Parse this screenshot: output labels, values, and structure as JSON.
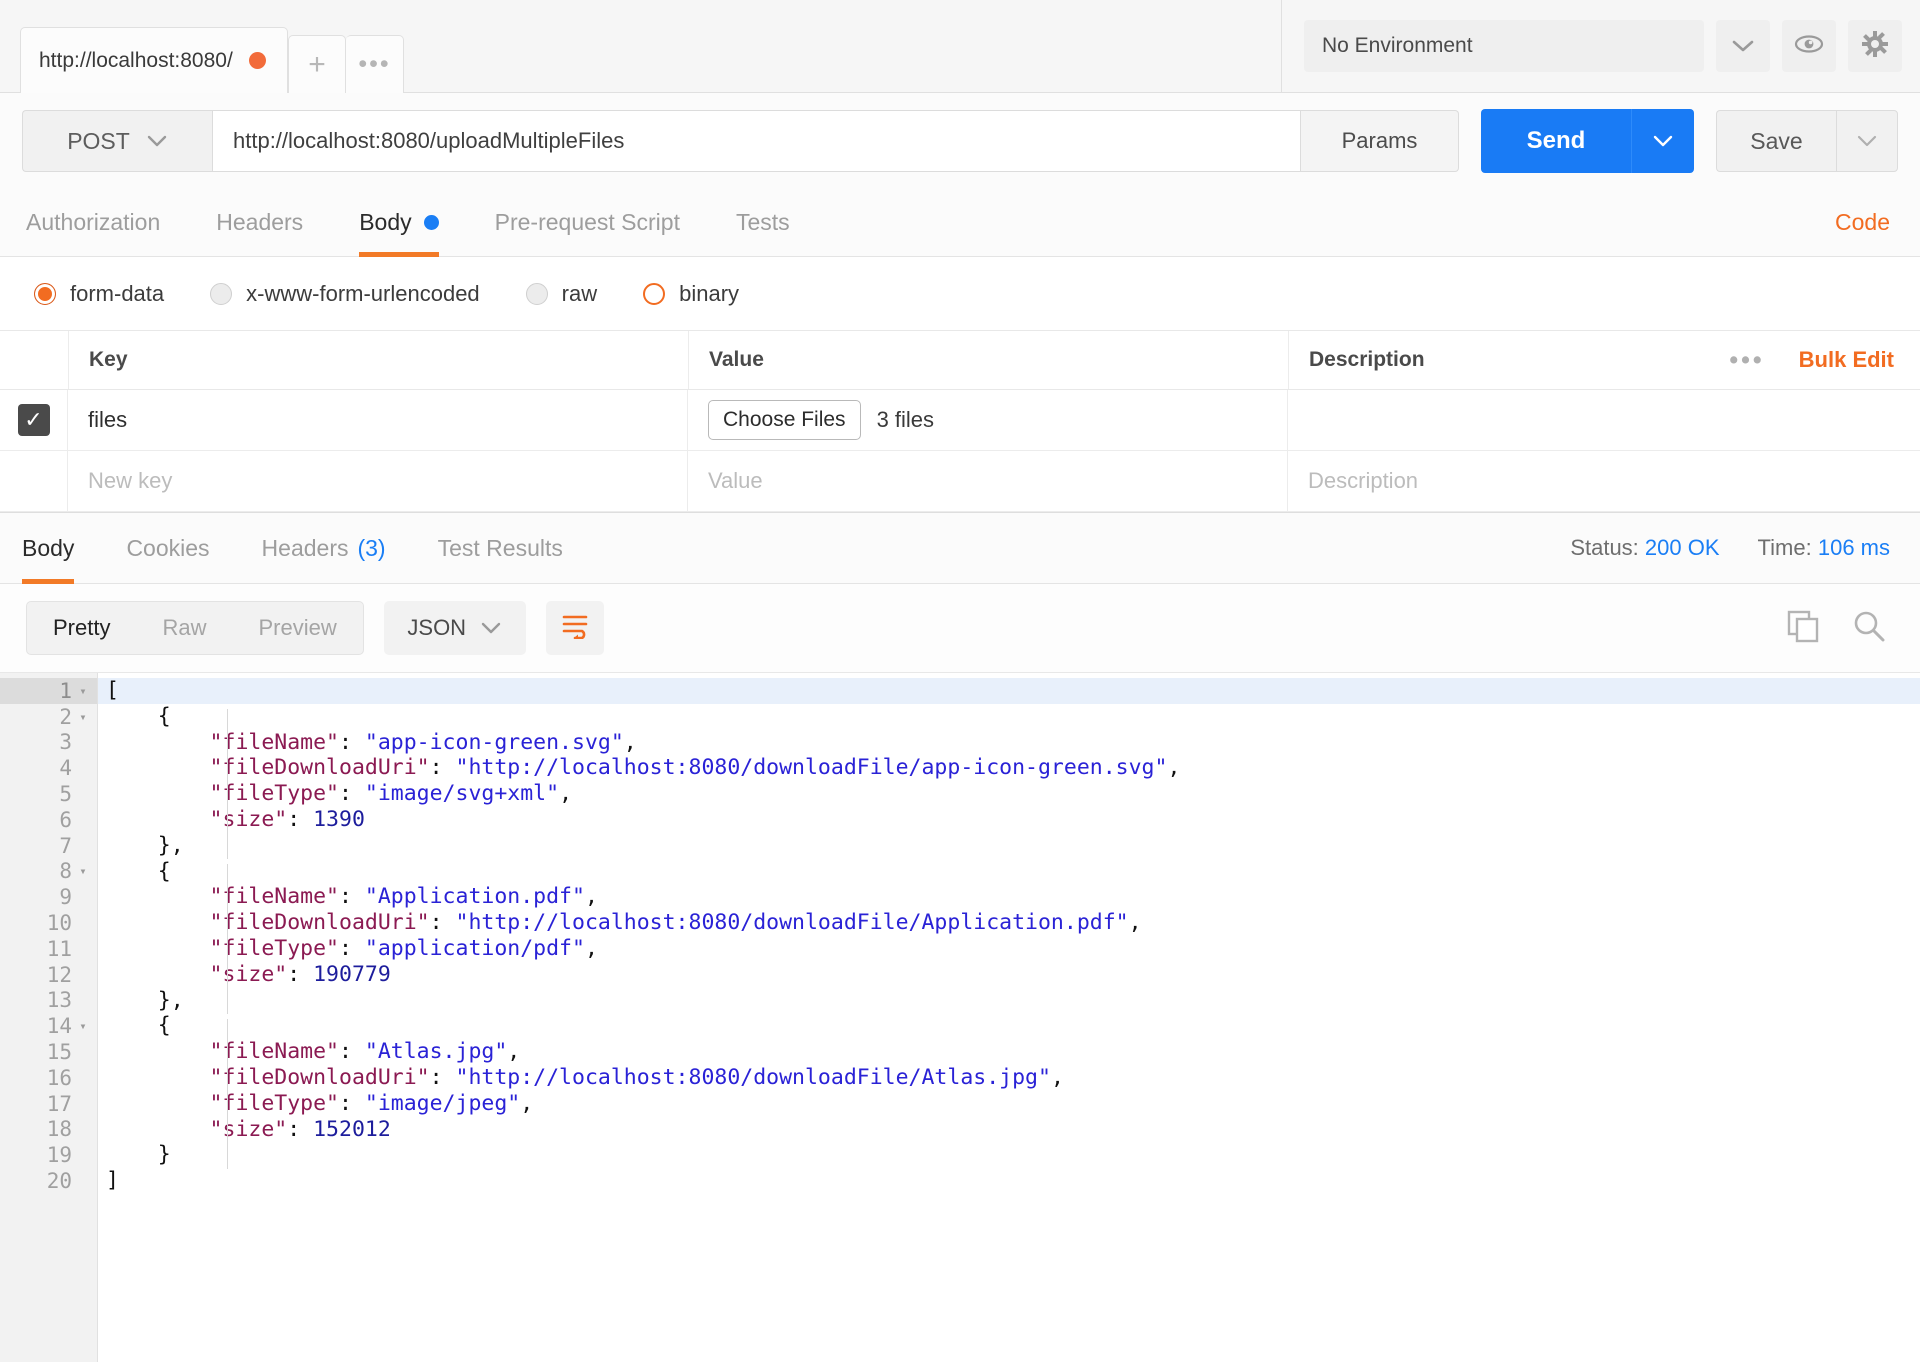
{
  "topbar": {
    "tab_title": "http://localhost:8080/",
    "unsaved_indicator": "unsaved",
    "new_tab_label": "+",
    "more_tabs_label": "•••",
    "environment": "No Environment",
    "eye_icon": "eye-icon",
    "gear_icon": "gear-icon"
  },
  "request": {
    "method": "POST",
    "url": "http://localhost:8080/uploadMultipleFiles",
    "params_label": "Params",
    "send_label": "Send",
    "save_label": "Save",
    "tabs": [
      {
        "label": "Authorization",
        "active": false
      },
      {
        "label": "Headers",
        "active": false
      },
      {
        "label": "Body",
        "active": true,
        "dot": true
      },
      {
        "label": "Pre-request Script",
        "active": false
      },
      {
        "label": "Tests",
        "active": false
      }
    ],
    "code_link": "Code",
    "body_types": [
      {
        "label": "form-data",
        "state": "selected"
      },
      {
        "label": "x-www-form-urlencoded",
        "state": "off"
      },
      {
        "label": "raw",
        "state": "off"
      },
      {
        "label": "binary",
        "state": "hover"
      }
    ],
    "table": {
      "headers": [
        "Key",
        "Value",
        "Description"
      ],
      "more_label": "•••",
      "bulk_edit_label": "Bulk Edit",
      "rows": [
        {
          "checked": true,
          "key": "files",
          "value_button": "Choose Files",
          "value_text": "3 files",
          "description": ""
        }
      ],
      "new_row": {
        "key_placeholder": "New key",
        "value_placeholder": "Value",
        "description_placeholder": "Description"
      }
    }
  },
  "response": {
    "tabs": [
      {
        "label": "Body",
        "active": true
      },
      {
        "label": "Cookies",
        "active": false
      },
      {
        "label": "Headers",
        "count": "(3)",
        "active": false
      },
      {
        "label": "Test Results",
        "active": false
      }
    ],
    "status_label": "Status:",
    "status_value": "200 OK",
    "time_label": "Time:",
    "time_value": "106 ms",
    "view_modes": [
      {
        "label": "Pretty",
        "active": true
      },
      {
        "label": "Raw",
        "active": false
      },
      {
        "label": "Preview",
        "active": false
      }
    ],
    "format": "JSON",
    "wrap_icon": "word-wrap-icon",
    "copy_icon": "copy-icon",
    "search_icon": "search-icon",
    "body_lines": [
      {
        "n": 1,
        "fold": true,
        "highlight": true,
        "tokens": [
          {
            "t": "p",
            "v": "["
          }
        ]
      },
      {
        "n": 2,
        "fold": true,
        "tokens": [
          {
            "t": "p",
            "v": "    {"
          }
        ]
      },
      {
        "n": 3,
        "tokens": [
          {
            "t": "k",
            "v": "        \"fileName\""
          },
          {
            "t": "p",
            "v": ": "
          },
          {
            "t": "s",
            "v": "\"app-icon-green.svg\""
          },
          {
            "t": "p",
            "v": ","
          }
        ]
      },
      {
        "n": 4,
        "tokens": [
          {
            "t": "k",
            "v": "        \"fileDownloadUri\""
          },
          {
            "t": "p",
            "v": ": "
          },
          {
            "t": "s",
            "v": "\"http://localhost:8080/downloadFile/app-icon-green.svg\""
          },
          {
            "t": "p",
            "v": ","
          }
        ]
      },
      {
        "n": 5,
        "tokens": [
          {
            "t": "k",
            "v": "        \"fileType\""
          },
          {
            "t": "p",
            "v": ": "
          },
          {
            "t": "s",
            "v": "\"image/svg+xml\""
          },
          {
            "t": "p",
            "v": ","
          }
        ]
      },
      {
        "n": 6,
        "tokens": [
          {
            "t": "k",
            "v": "        \"size\""
          },
          {
            "t": "p",
            "v": ": "
          },
          {
            "t": "n",
            "v": "1390"
          }
        ]
      },
      {
        "n": 7,
        "tokens": [
          {
            "t": "p",
            "v": "    },"
          }
        ]
      },
      {
        "n": 8,
        "fold": true,
        "tokens": [
          {
            "t": "p",
            "v": "    {"
          }
        ]
      },
      {
        "n": 9,
        "tokens": [
          {
            "t": "k",
            "v": "        \"fileName\""
          },
          {
            "t": "p",
            "v": ": "
          },
          {
            "t": "s",
            "v": "\"Application.pdf\""
          },
          {
            "t": "p",
            "v": ","
          }
        ]
      },
      {
        "n": 10,
        "tokens": [
          {
            "t": "k",
            "v": "        \"fileDownloadUri\""
          },
          {
            "t": "p",
            "v": ": "
          },
          {
            "t": "s",
            "v": "\"http://localhost:8080/downloadFile/Application.pdf\""
          },
          {
            "t": "p",
            "v": ","
          }
        ]
      },
      {
        "n": 11,
        "tokens": [
          {
            "t": "k",
            "v": "        \"fileType\""
          },
          {
            "t": "p",
            "v": ": "
          },
          {
            "t": "s",
            "v": "\"application/pdf\""
          },
          {
            "t": "p",
            "v": ","
          }
        ]
      },
      {
        "n": 12,
        "tokens": [
          {
            "t": "k",
            "v": "        \"size\""
          },
          {
            "t": "p",
            "v": ": "
          },
          {
            "t": "n",
            "v": "190779"
          }
        ]
      },
      {
        "n": 13,
        "tokens": [
          {
            "t": "p",
            "v": "    },"
          }
        ]
      },
      {
        "n": 14,
        "fold": true,
        "tokens": [
          {
            "t": "p",
            "v": "    {"
          }
        ]
      },
      {
        "n": 15,
        "tokens": [
          {
            "t": "k",
            "v": "        \"fileName\""
          },
          {
            "t": "p",
            "v": ": "
          },
          {
            "t": "s",
            "v": "\"Atlas.jpg\""
          },
          {
            "t": "p",
            "v": ","
          }
        ]
      },
      {
        "n": 16,
        "tokens": [
          {
            "t": "k",
            "v": "        \"fileDownloadUri\""
          },
          {
            "t": "p",
            "v": ": "
          },
          {
            "t": "s",
            "v": "\"http://localhost:8080/downloadFile/Atlas.jpg\""
          },
          {
            "t": "p",
            "v": ","
          }
        ]
      },
      {
        "n": 17,
        "tokens": [
          {
            "t": "k",
            "v": "        \"fileType\""
          },
          {
            "t": "p",
            "v": ": "
          },
          {
            "t": "s",
            "v": "\"image/jpeg\""
          },
          {
            "t": "p",
            "v": ","
          }
        ]
      },
      {
        "n": 18,
        "tokens": [
          {
            "t": "k",
            "v": "        \"size\""
          },
          {
            "t": "p",
            "v": ": "
          },
          {
            "t": "n",
            "v": "152012"
          }
        ]
      },
      {
        "n": 19,
        "tokens": [
          {
            "t": "p",
            "v": "    }"
          }
        ]
      },
      {
        "n": 20,
        "tokens": [
          {
            "t": "p",
            "v": "]"
          }
        ]
      }
    ]
  },
  "colors": {
    "accent_orange": "#f26c21",
    "send_blue": "#197bf5",
    "status_blue": "#1a7ef5"
  }
}
